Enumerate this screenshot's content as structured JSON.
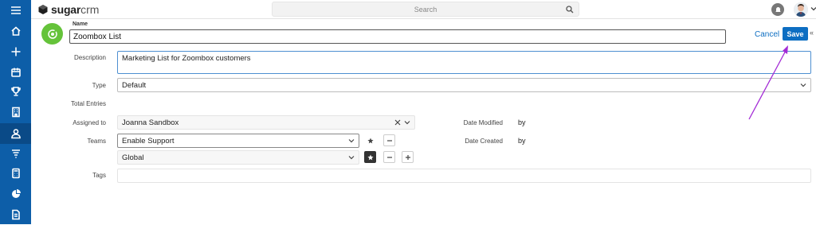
{
  "app": {
    "logo_bold": "sugar",
    "logo_light": "crm",
    "search_placeholder": "Search"
  },
  "nav": [
    "menu-icon",
    "home-icon",
    "plus-icon",
    "calendar-icon",
    "trophy-icon",
    "building-icon",
    "contacts-icon",
    "filter-icon",
    "calculator-icon",
    "pie-chart-icon",
    "document-icon"
  ],
  "record": {
    "name_label": "Name",
    "name_value": "Zoombox List",
    "cancel_label": "Cancel",
    "save_label": "Save"
  },
  "form": {
    "description_label": "Description",
    "description_value": "Marketing List for Zoombox customers",
    "type_label": "Type",
    "type_value": "Default",
    "total_entries_label": "Total Entries",
    "assigned_label": "Assigned to",
    "assigned_value": "Joanna Sandbox",
    "teams_label": "Teams",
    "team1_value": "Enable Support",
    "team2_value": "Global",
    "tags_label": "Tags",
    "date_modified_label": "Date Modified",
    "date_modified_value": "by",
    "date_created_label": "Date Created",
    "date_created_value": "by"
  },
  "colors": {
    "rail": "#0d5ea8",
    "primary": "#0d6ec2",
    "module_icon": "#65c33a",
    "annotation": "#a32bd6"
  }
}
